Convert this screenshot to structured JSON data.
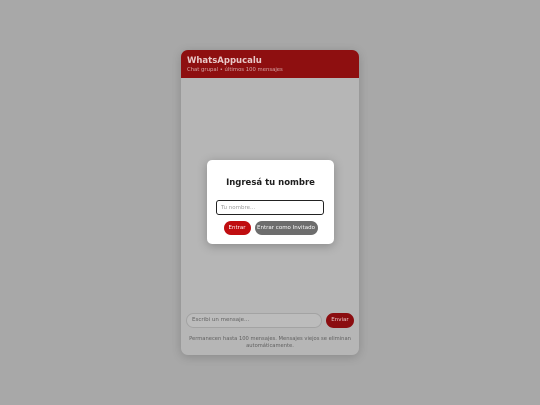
{
  "app": {
    "title": "WhatsAppucalu",
    "subtitle": "Chat grupal • últimos 100 mensajes"
  },
  "composer": {
    "placeholder": "Escribí un mensaje...",
    "send_label": "Enviar"
  },
  "footer": {
    "note": "Permanecen hasta 100 mensajes. Mensajes viejos se eliminan automáticamente."
  },
  "modal": {
    "title": "Ingresá tu nombre",
    "name_placeholder": "Tu nombre...",
    "enter_label": "Entrar",
    "guest_label": "Entrar como Invitado"
  },
  "colors": {
    "brand": "#8e0f10",
    "primary_button": "#c00d10",
    "secondary_button": "#6d6d6d",
    "overlay": "#a8a8a8"
  }
}
